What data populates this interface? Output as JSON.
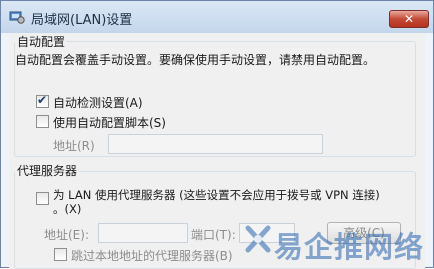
{
  "window": {
    "title": "局域网(LAN)设置",
    "close_label": "✕"
  },
  "auto_config": {
    "legend": "自动配置",
    "description": "自动配置会覆盖手动设置。要确保使用手动设置，请禁用自动配置。",
    "auto_detect": {
      "label": "自动检测设置(A)",
      "checked": true
    },
    "use_script": {
      "label": "使用自动配置脚本(S)",
      "checked": false
    },
    "address_label": "地址(R)",
    "address_value": ""
  },
  "proxy": {
    "legend": "代理服务器",
    "use_proxy_label_line1": "为 LAN 使用代理服务器 (这些设置不会应用于拨号或 VPN 连接)",
    "use_proxy_label_line2": "。(X)",
    "use_proxy_checked": false,
    "address_label": "地址(E):",
    "address_value": "",
    "port_label": "端口(T):",
    "port_value": "",
    "advanced_label": "高级(C)",
    "bypass_local": {
      "label": "跳过本地地址的代理服务器(B)",
      "checked": false
    }
  },
  "watermark": {
    "text": "易企推网络"
  },
  "colors": {
    "accent": "#1f3a68",
    "watermark": "#2864af",
    "close": "#c44a37"
  }
}
